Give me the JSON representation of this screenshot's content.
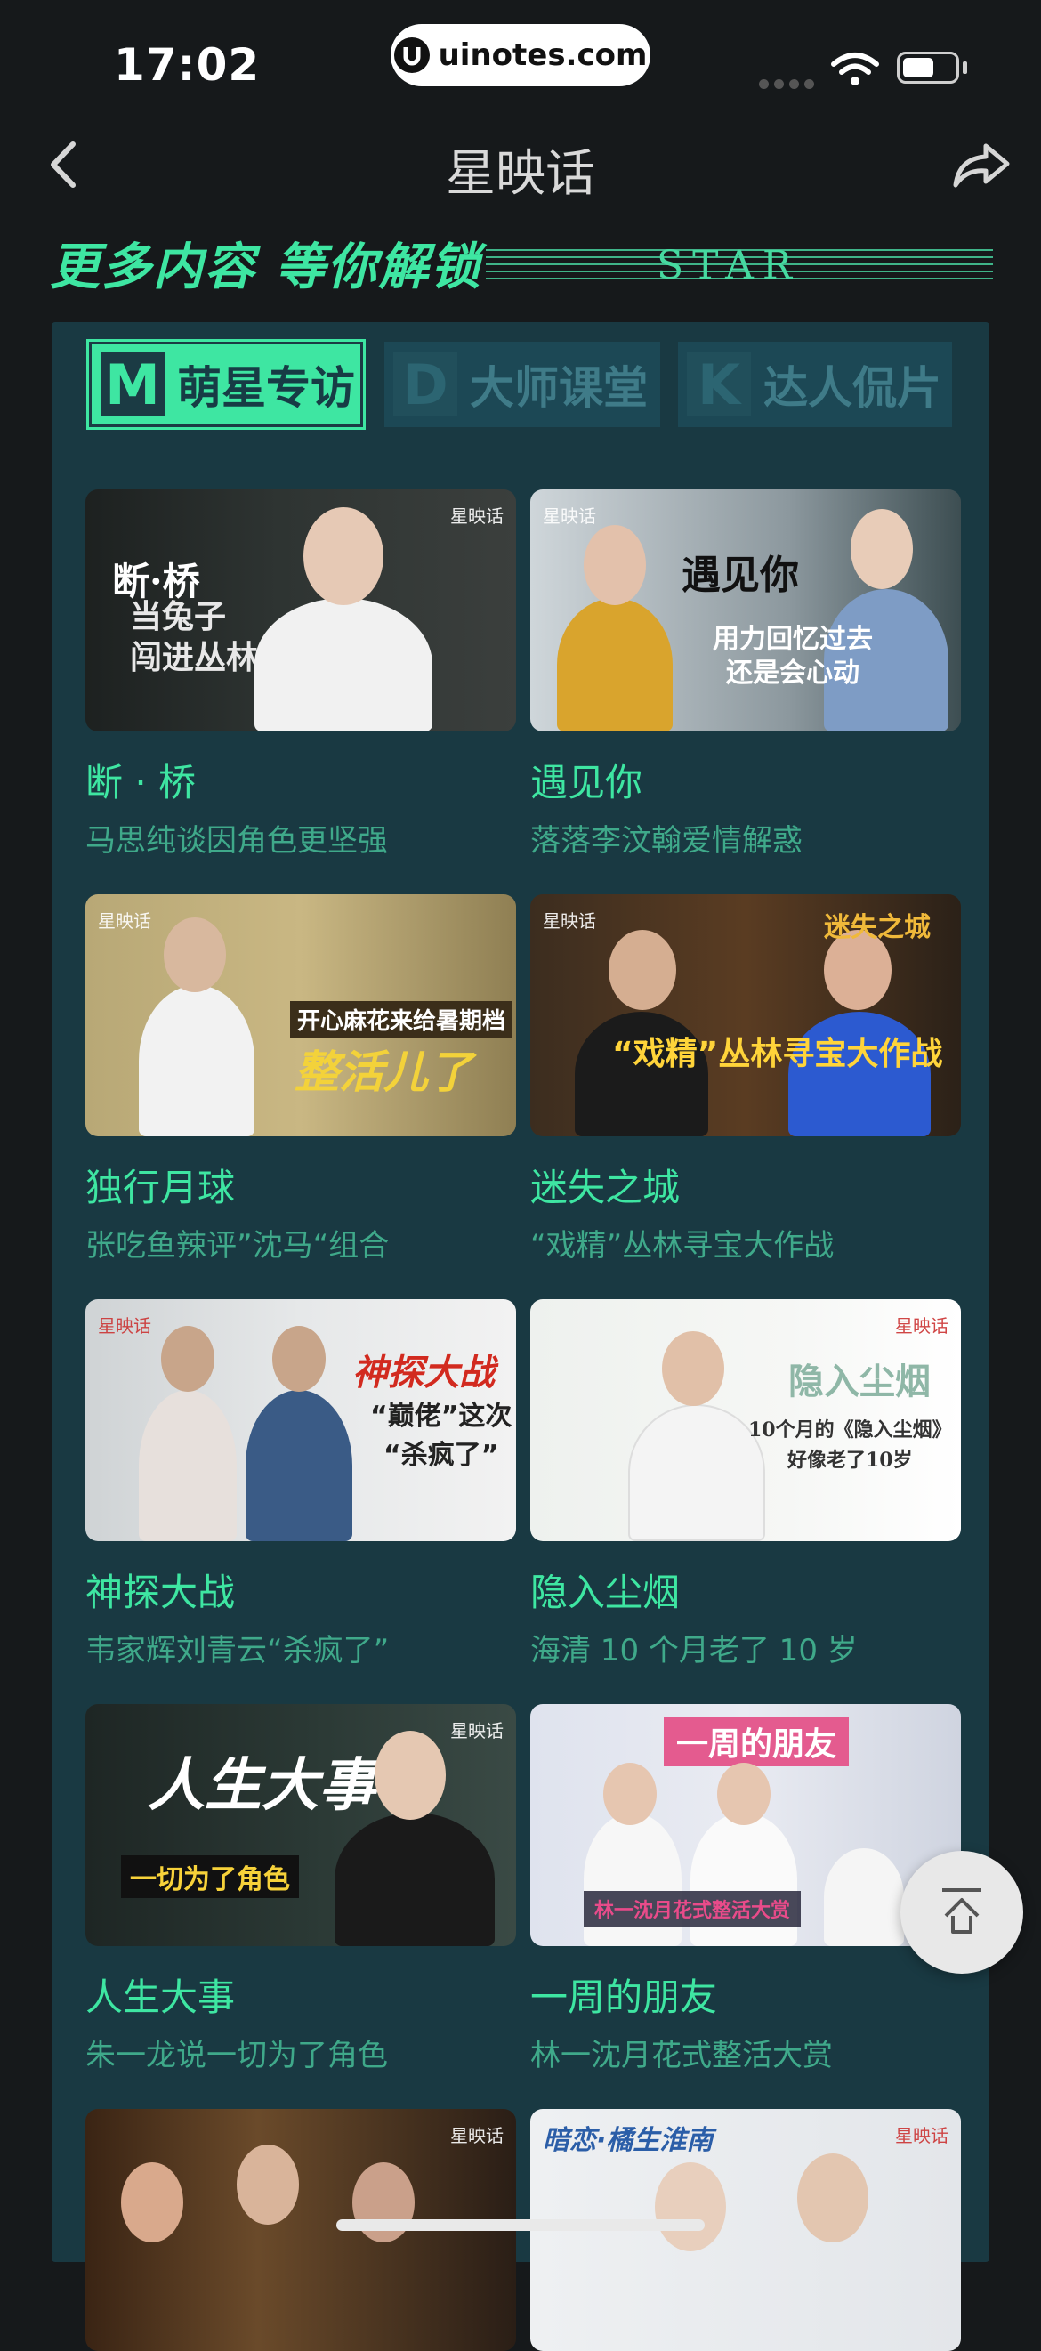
{
  "status": {
    "time": "17:02",
    "url": "uinotes.com"
  },
  "nav": {
    "title": "星映话"
  },
  "banner": {
    "text": "更多内容 等你解锁",
    "star": "STAR"
  },
  "tabs": [
    {
      "letter": "M",
      "label": "萌星专访"
    },
    {
      "letter": "D",
      "label": "大师课堂"
    },
    {
      "letter": "K",
      "label": "达人侃片"
    }
  ],
  "thumb_logo": "星映话",
  "cards": [
    {
      "title": "断 · 桥",
      "subtitle": "马思纯谈因角色更坚强",
      "thumb_text": "当兔子\n闯进丛林",
      "thumb_logo_text": "断·桥"
    },
    {
      "title": "遇见你",
      "subtitle": "落落李汶翰爱情解惑",
      "thumb_text": "用力回忆过去\n还是会心动",
      "thumb_logo_text": "遇见你"
    },
    {
      "title": "独行月球",
      "subtitle": "张吃鱼辣评”沈马“组合",
      "thumb_text": "整活儿了",
      "thumb_tag": "开心麻花来给暑期档"
    },
    {
      "title": "迷失之城",
      "subtitle": "“戏精”丛林寻宝大作战",
      "thumb_text": "“戏精”丛林寻宝大作战",
      "thumb_logo_text": "迷失之城"
    },
    {
      "title": "神探大战",
      "subtitle": "韦家辉刘青云“杀疯了”",
      "thumb_text": "“巅佬”这次\n“杀疯了”",
      "thumb_logo_text": "神探大战"
    },
    {
      "title": "隐入尘烟",
      "subtitle": "海清 10 个月老了 10 岁",
      "thumb_text": "10个月的《隐入尘烟》\n好像老了10岁",
      "thumb_logo_text": "隐入尘烟"
    },
    {
      "title": "人生大事",
      "subtitle": "朱一龙说一切为了角色",
      "thumb_text": "一切为了角色",
      "thumb_logo_text": "人生大事"
    },
    {
      "title": "一周的朋友",
      "subtitle": "林一沈月花式整活大赏",
      "thumb_text": "林一沈月花式整活大赏",
      "thumb_logo_text": "一周的朋友"
    },
    {
      "title": "",
      "subtitle": "",
      "thumb_text": ""
    },
    {
      "title": "",
      "subtitle": "",
      "thumb_text": "",
      "thumb_logo_text": "暗恋·橘生淮南"
    }
  ]
}
